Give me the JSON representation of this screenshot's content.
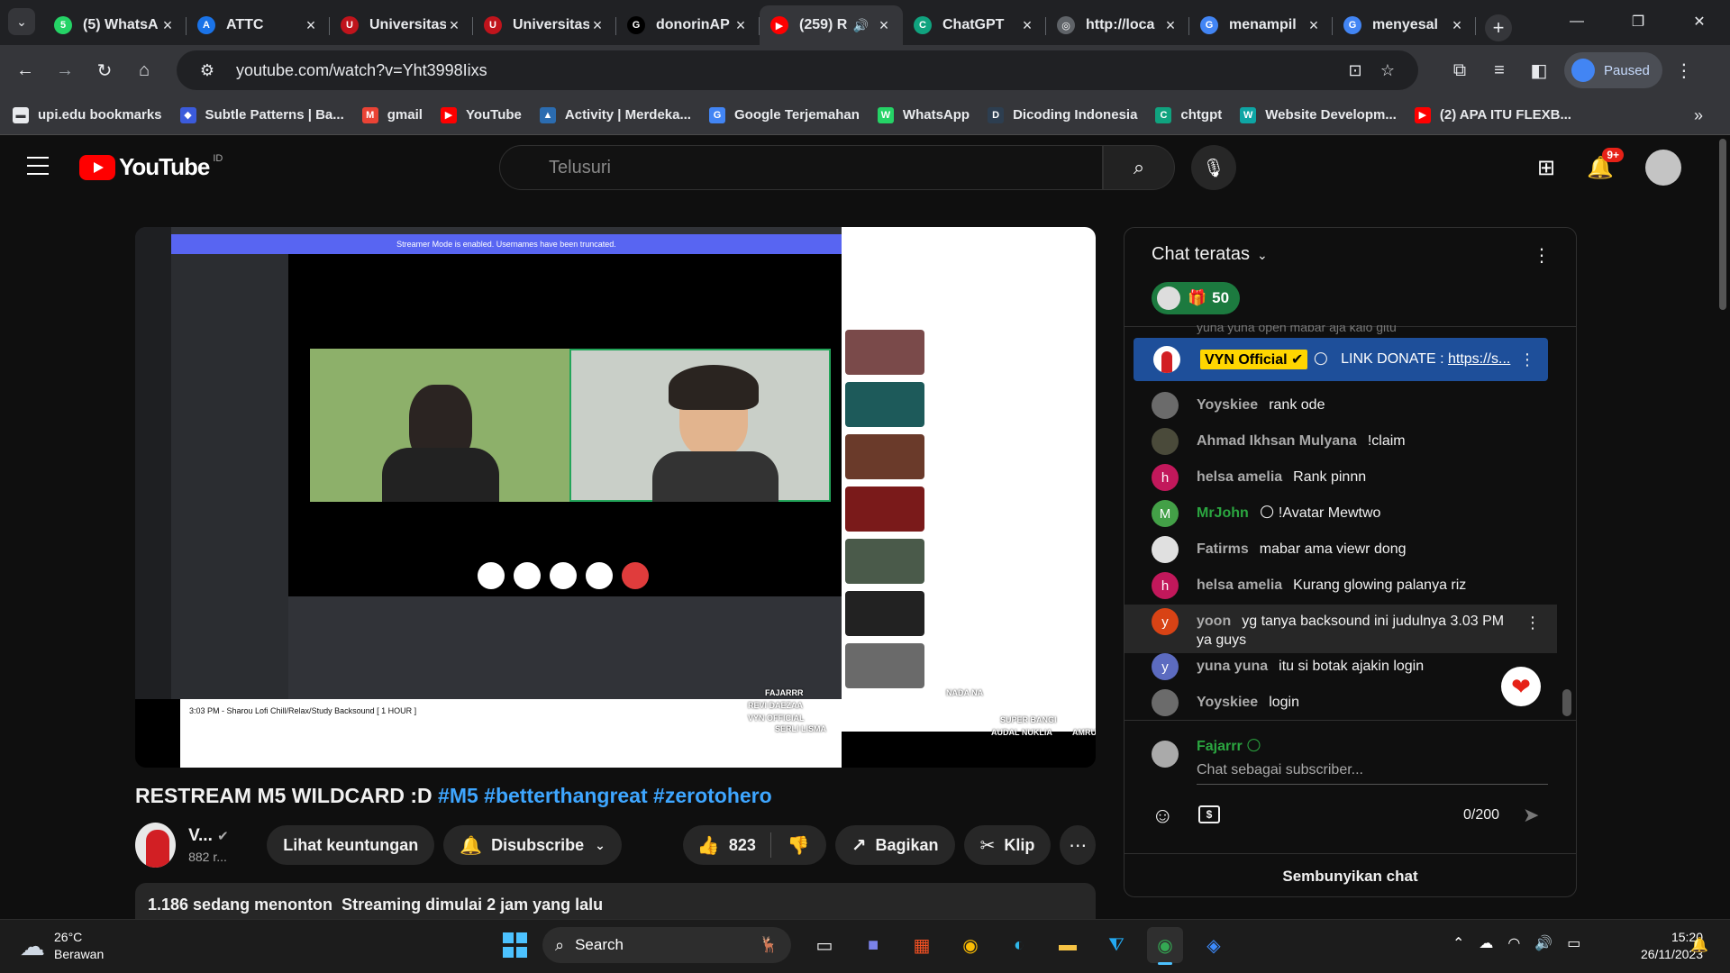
{
  "browser": {
    "tabs": [
      {
        "title": "(5) WhatsA",
        "icon": "whatsapp-icon",
        "color": "#25d366",
        "glyph": "5"
      },
      {
        "title": "ATTC",
        "icon": "attc-icon",
        "color": "#1a73e8",
        "glyph": "A"
      },
      {
        "title": "Universitas",
        "icon": "upi-icon",
        "color": "#c0141c",
        "glyph": "U"
      },
      {
        "title": "Universitas",
        "icon": "upi-icon",
        "color": "#c0141c",
        "glyph": "U"
      },
      {
        "title": "donorinAP",
        "icon": "github-icon",
        "color": "#000000",
        "glyph": "G"
      },
      {
        "title": "(259) R",
        "icon": "youtube-icon",
        "color": "#ff0000",
        "glyph": "▶",
        "active": true
      },
      {
        "title": "ChatGPT",
        "icon": "chatgpt-icon",
        "color": "#10a37f",
        "glyph": "C"
      },
      {
        "title": "http://loca",
        "icon": "globe-icon",
        "color": "#5f6368",
        "glyph": "◎"
      },
      {
        "title": "menampil",
        "icon": "google-icon",
        "color": "#4285f4",
        "glyph": "G"
      },
      {
        "title": "menyesal",
        "icon": "google-icon",
        "color": "#4285f4",
        "glyph": "G"
      }
    ],
    "url": "youtube.com/watch?v=Yht3998Iixs",
    "profile_status": "Paused",
    "bookmarks": [
      {
        "label": "upi.edu bookmarks",
        "icon": "folder-icon",
        "color": "#e8eaed",
        "glyph": "▬"
      },
      {
        "label": "Subtle Patterns | Ba...",
        "icon": "subtle-patterns-icon",
        "color": "#3b5bdb",
        "glyph": "◆"
      },
      {
        "label": "gmail",
        "icon": "gmail-icon",
        "color": "#ea4335",
        "glyph": "M"
      },
      {
        "label": "YouTube",
        "icon": "youtube-icon",
        "color": "#ff0000",
        "glyph": "▶"
      },
      {
        "label": "Activity | Merdeka...",
        "icon": "merdeka-icon",
        "color": "#2b6cb0",
        "glyph": "▲"
      },
      {
        "label": "Google Terjemahan",
        "icon": "translate-icon",
        "color": "#4285f4",
        "glyph": "G"
      },
      {
        "label": "WhatsApp",
        "icon": "whatsapp-icon",
        "color": "#25d366",
        "glyph": "W"
      },
      {
        "label": "Dicoding Indonesia",
        "icon": "dicoding-icon",
        "color": "#2d3e50",
        "glyph": "D"
      },
      {
        "label": "chtgpt",
        "icon": "chatgpt-icon",
        "color": "#10a37f",
        "glyph": "C"
      },
      {
        "label": "Website Developm...",
        "icon": "website-icon",
        "color": "#0ea5a4",
        "glyph": "W"
      },
      {
        "label": "(2) APA ITU FLEXB...",
        "icon": "youtube-icon",
        "color": "#ff0000",
        "glyph": "▶"
      }
    ]
  },
  "youtube": {
    "logo_text": "YouTube",
    "country_code": "ID",
    "search_placeholder": "Telusuri",
    "notification_count": "9+",
    "video": {
      "title": "RESTREAM M5 WILDCARD :D",
      "hashtags": "#M5 #betterthangreat #zerotohero",
      "channel_name": "V...",
      "subscribers": "882 r...",
      "perks_label": "Lihat keuntungan",
      "subscribe_label": "Disubscribe",
      "likes": "823",
      "share_label": "Bagikan",
      "clip_label": "Klip",
      "viewers": "1.186 sedang menonton",
      "started": "Streaming dimulai 2 jam yang lalu"
    },
    "player_content": {
      "banner": "Streamer Mode is enabled. Usernames have been truncated.",
      "embedded_title": "3:03 PM - Sharou Lofi Chill/Relax/Study Backsound [ 1 HOUR ]",
      "overlay_names": [
        "FAJARRR",
        "REVI DAEZAA",
        "VYN OFFICIAL",
        "SERLI LISMA",
        "NADA NA",
        "SUPER BANGI",
        "AUDAL NUKLIA",
        "AMRU MUBARAK"
      ]
    },
    "chat": {
      "header": "Chat teratas",
      "gift_count": "50",
      "pinned": {
        "author": "VYN Official",
        "message": "LINK DONATE : ",
        "link": "https://s..."
      },
      "messages": [
        {
          "author": "Yoyskiee",
          "text": "rank ode",
          "avatar_color": "#6b6b6b",
          "initial": ""
        },
        {
          "author": "Ahmad Ikhsan Mulyana",
          "text": "!claim",
          "avatar_color": "#4a4a3a",
          "initial": ""
        },
        {
          "author": "helsa amelia",
          "text": "Rank pinnn",
          "avatar_color": "#c2185b",
          "initial": "h"
        },
        {
          "author": "MrJohn",
          "text": "!Avatar Mewtwo",
          "avatar_color": "#43a047",
          "initial": "M",
          "member": true
        },
        {
          "author": "Fatirms",
          "text": "mabar ama viewr dong",
          "avatar_color": "#e0e0e0",
          "initial": ""
        },
        {
          "author": "helsa amelia",
          "text": "Kurang glowing palanya riz",
          "avatar_color": "#c2185b",
          "initial": "h"
        },
        {
          "author": "yoon",
          "text": "yg tanya backsound ini judulnya 3.03 PM ya guys",
          "avatar_color": "#d84315",
          "initial": "y",
          "highlight": true
        },
        {
          "author": "yuna yuna",
          "text": "itu si botak ajakin login",
          "avatar_color": "#5c6bc0",
          "initial": "y"
        },
        {
          "author": "Yoyskiee",
          "text": "login",
          "avatar_color": "#6b6b6b",
          "initial": ""
        }
      ],
      "faded_message": "yuna yuna   open mabar aja kalo gitu",
      "composer_name": "Fajarrr",
      "composer_placeholder": "Chat sebagai subscriber...",
      "char_count": "0/200",
      "hide_chat": "Sembunyikan chat"
    }
  },
  "taskbar": {
    "temperature": "26°C",
    "weather": "Berawan",
    "search_label": "Search",
    "time": "15:20",
    "date": "26/11/2023"
  }
}
